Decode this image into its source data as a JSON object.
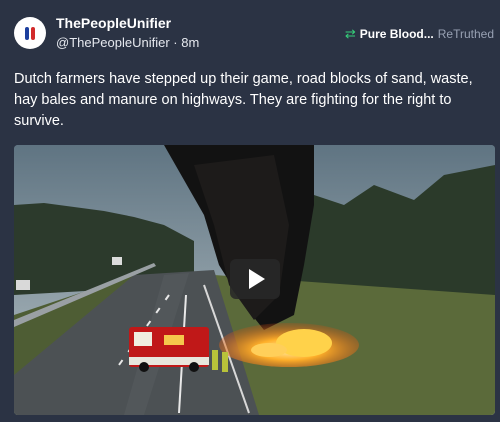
{
  "post": {
    "author_name": "ThePeopleUnifier",
    "author_handle": "@ThePeopleUnifier",
    "separator": "·",
    "time_ago": "8m",
    "retruth": {
      "user": "Pure Blood...",
      "label": "ReTruthed",
      "icon": "retruth-icon"
    },
    "text": "Dutch farmers have stepped up their game, road blocks of sand, waste, hay bales and manure on highways. They are fighting for the right to survive.",
    "media": {
      "type": "video",
      "play_icon": "play-icon"
    }
  },
  "colors": {
    "background": "#2b3344",
    "retruth_icon": "#36d07a",
    "muted_text": "#98a1b3"
  }
}
